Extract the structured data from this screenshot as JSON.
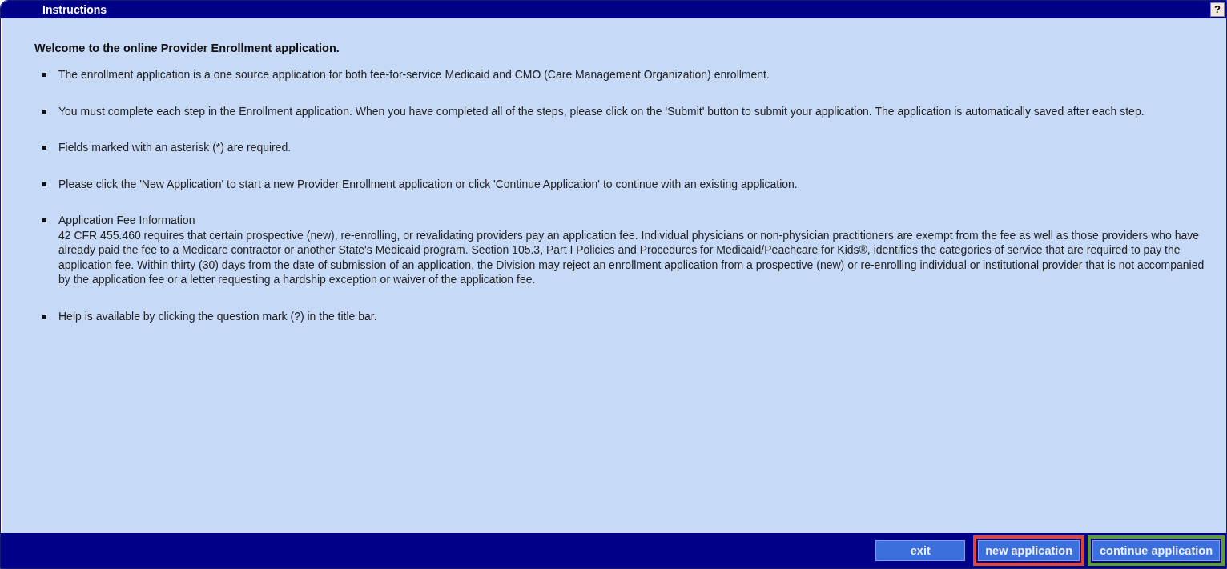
{
  "window": {
    "title": "Instructions",
    "help_button": "?"
  },
  "heading": "Welcome to the online Provider Enrollment application.",
  "items": [
    {
      "kind": "plain",
      "text": "The enrollment application is a one source application for both fee-for-service Medicaid and CMO (Care Management Organization) enrollment."
    },
    {
      "kind": "plain",
      "text": "You must complete each step in the Enrollment application. When you have completed all of the steps, please click on the 'Submit' button to submit your application. The application is automatically saved after each step."
    },
    {
      "kind": "plain",
      "text": "Fields marked with an asterisk (*) are required."
    },
    {
      "kind": "plain",
      "text": "Please click the 'New Application' to start a new Provider Enrollment application or click 'Continue Application' to continue with an existing application."
    },
    {
      "kind": "titled",
      "title": "Application Fee Information",
      "text": "42 CFR 455.460 requires that certain prospective (new), re-enrolling, or revalidating providers pay an application fee. Individual physicians or non-physician practitioners are exempt from the fee as well as those providers who have already paid the fee to a Medicare contractor or another State's Medicaid program. Section 105.3, Part I Policies and Procedures for Medicaid/Peachcare for Kids®, identifies the categories of service that are required to pay the application fee. Within thirty (30) days from the date of submission of an application, the Division may reject an enrollment application from a prospective (new) or re-enrolling individual or institutional provider that is not accompanied by the application fee or a letter requesting a hardship exception or waiver of the application fee."
    },
    {
      "kind": "plain",
      "text": "Help is available by clicking the question mark (?) in the title bar."
    }
  ],
  "buttons": [
    {
      "label": "exit"
    },
    {
      "label": "new application",
      "color": "#e0453a"
    },
    {
      "label": "continue application",
      "color": "#5a9e32"
    }
  ]
}
